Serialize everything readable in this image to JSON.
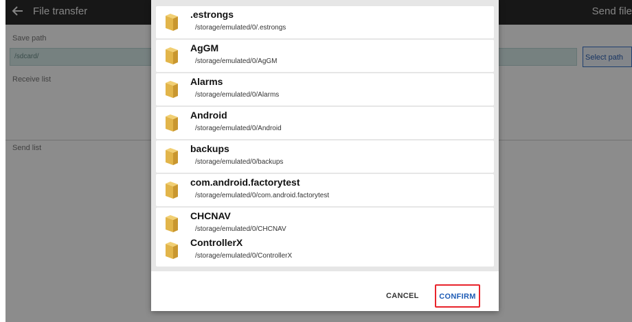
{
  "app": {
    "title": "File transfer",
    "send_label": "Send file",
    "save_path_label": "Save path",
    "save_path_value": "/sdcard/",
    "select_path_label": "Select path",
    "receive_list_label": "Receive list",
    "send_list_label": "Send list"
  },
  "dialog": {
    "folders": [
      {
        "name": ".estrongs",
        "path": "/storage/emulated/0/.estrongs"
      },
      {
        "name": "AgGM",
        "path": "/storage/emulated/0/AgGM"
      },
      {
        "name": "Alarms",
        "path": "/storage/emulated/0/Alarms"
      },
      {
        "name": "Android",
        "path": "/storage/emulated/0/Android"
      },
      {
        "name": "backups",
        "path": "/storage/emulated/0/backups"
      },
      {
        "name": "com.android.factorytest",
        "path": "/storage/emulated/0/com.android.factorytest"
      },
      {
        "name": "CHCNAV",
        "path": "/storage/emulated/0/CHCNAV"
      },
      {
        "name": "ControllerX",
        "path": "/storage/emulated/0/ControllerX"
      }
    ],
    "cancel_label": "CANCEL",
    "confirm_label": "CONFIRM"
  },
  "colors": {
    "confirm_highlight": "#e8232a",
    "confirm_text": "#1d5bb5",
    "folder_icon": "#e2b54a"
  },
  "icons": {
    "back": "arrow-left-icon",
    "folder": "folder-icon"
  }
}
